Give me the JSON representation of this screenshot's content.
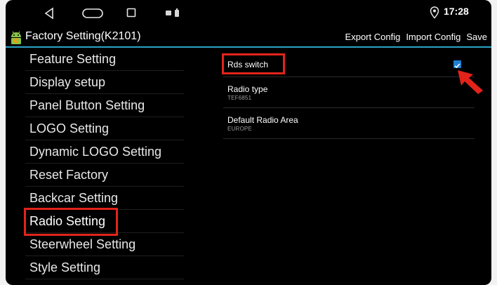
{
  "status_bar": {
    "time": "17:28",
    "icons": [
      "back-icon",
      "home-icon",
      "recents-icon",
      "notification-icon",
      "location-icon"
    ]
  },
  "app_bar": {
    "title": "Factory Setting(K2101)",
    "actions": {
      "export": "Export Config",
      "import": "Import Config",
      "save": "Save"
    }
  },
  "menu": {
    "items": [
      {
        "label": "Feature Setting"
      },
      {
        "label": "Display setup"
      },
      {
        "label": "Panel Button Setting"
      },
      {
        "label": "LOGO Setting"
      },
      {
        "label": "Dynamic LOGO Setting"
      },
      {
        "label": "Reset Factory"
      },
      {
        "label": "Backcar Setting"
      },
      {
        "label": "Radio Setting"
      },
      {
        "label": "Steerwheel Setting"
      },
      {
        "label": "Style Setting"
      }
    ],
    "selected": "Radio Setting"
  },
  "settings": {
    "rds_switch": {
      "label": "Rds switch",
      "checked": true
    },
    "radio_type": {
      "label": "Radio type",
      "value": "TEF6851"
    },
    "default_area": {
      "label": "Default Radio Area",
      "value": "EUROPE"
    }
  },
  "colors": {
    "accent": "#2aa3c8",
    "highlight": "#e3231b",
    "checkbox": "#1e7fd1",
    "background": "#000000"
  }
}
